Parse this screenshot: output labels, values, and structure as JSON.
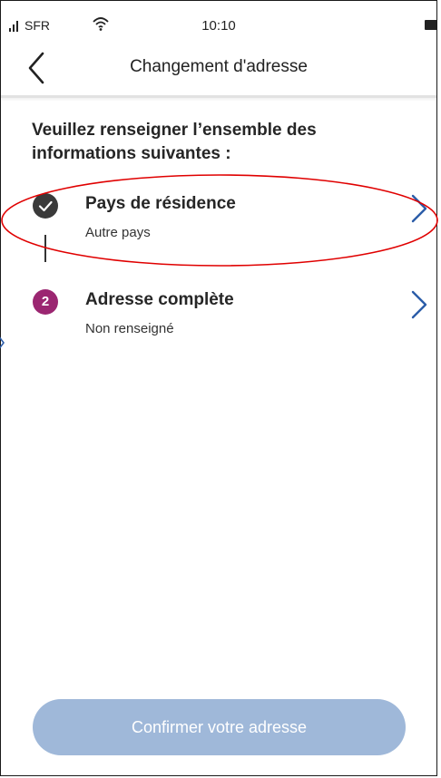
{
  "status_bar": {
    "carrier": "SFR",
    "time": "10:10"
  },
  "header": {
    "title": "Changement d'adresse",
    "back_icon": "chevron-left-icon"
  },
  "intro": {
    "text": "Veuillez renseigner l’ensemble des informations suivantes :"
  },
  "steps": [
    {
      "badge": "",
      "badge_icon": "check-icon",
      "status": "completed",
      "title": "Pays de résidence",
      "subtitle": "Autre pays"
    },
    {
      "badge": "2",
      "status": "pending",
      "title": "Adresse complète",
      "subtitle": "Non renseigné"
    }
  ],
  "confirm": {
    "label": "Confirmer votre adresse"
  },
  "colors": {
    "completed_badge": "#3a3a3a",
    "pending_badge": "#9b2671",
    "chevron": "#2b5ca8",
    "button_disabled": "#9fb8d9",
    "annotation": "#e00000"
  }
}
